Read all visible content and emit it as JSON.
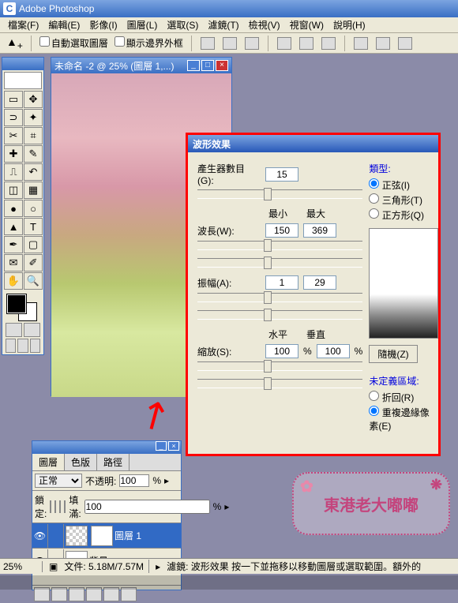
{
  "app": {
    "title": "Adobe Photoshop",
    "icon": "C"
  },
  "menu": {
    "file": "檔案(F)",
    "edit": "編輯(E)",
    "image": "影像(I)",
    "layer": "圖層(L)",
    "select": "選取(S)",
    "filter": "濾鏡(T)",
    "view": "檢視(V)",
    "window": "視窗(W)",
    "help": "說明(H)"
  },
  "optionbar": {
    "auto_select": "自動選取圖層",
    "show_bounds": "顯示邊界外框"
  },
  "document": {
    "title": "未命名 -2 @ 25% (圖層 1,...)"
  },
  "dialog": {
    "title": "波形效果",
    "generators_label": "產生器數目(G):",
    "generators_value": "15",
    "min_label": "最小",
    "max_label": "最大",
    "wavelength_label": "波長(W):",
    "wavelength_min": "150",
    "wavelength_max": "369",
    "amplitude_label": "振幅(A):",
    "amplitude_min": "1",
    "amplitude_max": "29",
    "horiz_label": "水平",
    "vert_label": "垂直",
    "scale_label": "縮放(S):",
    "scale_h": "100",
    "scale_v": "100",
    "pct": "%",
    "type_label": "類型:",
    "type_sine": "正弦(I)",
    "type_triangle": "三角形(T)",
    "type_square": "正方形(Q)",
    "type_selected": "sine",
    "randomize": "隨機(Z)",
    "undefined_label": "未定義區域:",
    "wrap": "折回(R)",
    "repeat": "重複邊緣像素(E)",
    "undefined_selected": "repeat"
  },
  "layers": {
    "tabs": {
      "layers": "圖層",
      "channels": "色版",
      "paths": "路徑"
    },
    "blend": "正常",
    "opacity_label": "不透明:",
    "opacity": "100",
    "pct": "%",
    "lock_label": "鎖定:",
    "fill_label": "填滿:",
    "fill": "100",
    "list": [
      {
        "name": "圖層 1",
        "selected": true
      },
      {
        "name": "背景",
        "selected": false
      }
    ]
  },
  "status": {
    "zoom": "25%",
    "doc": "文件: 5.18M/7.57M",
    "hint": "濾鏡: 波形效果  按一下並拖移以移動圖層或選取範圍。額外的"
  },
  "watermark": "東港老大嘟嘟"
}
